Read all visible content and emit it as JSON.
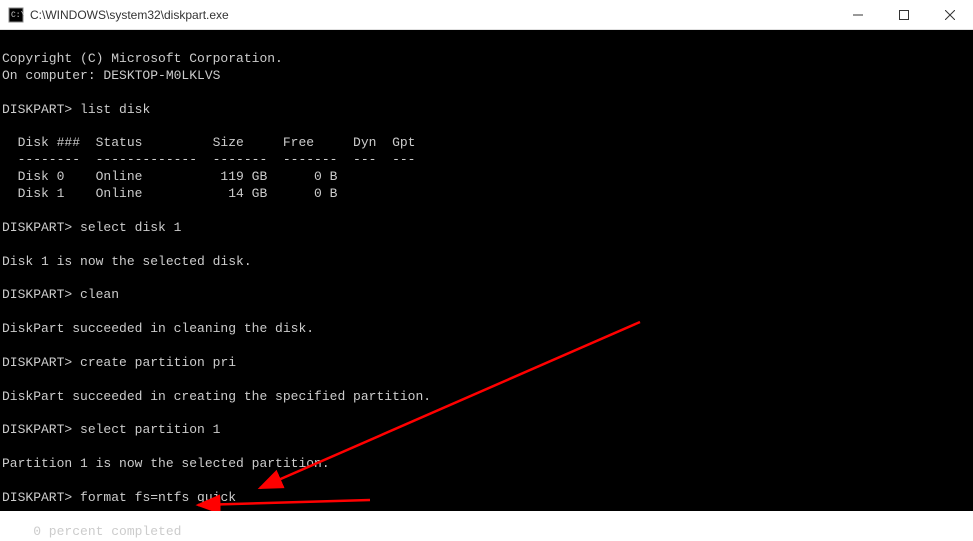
{
  "titlebar": {
    "title": "C:\\WINDOWS\\system32\\diskpart.exe"
  },
  "console": {
    "copyright": "Copyright (C) Microsoft Corporation.",
    "computer_line": "On computer: DESKTOP-M0LKLVS",
    "prompt": "DISKPART>",
    "cmd_list_disk": "list disk",
    "table_header": "  Disk ###  Status         Size     Free     Dyn  Gpt",
    "table_divider": "  --------  -------------  -------  -------  ---  ---",
    "disk0_row": "  Disk 0    Online          119 GB      0 B",
    "disk1_row": "  Disk 1    Online           14 GB      0 B",
    "cmd_select_disk": "select disk 1",
    "msg_disk_selected": "Disk 1 is now the selected disk.",
    "cmd_clean": "clean",
    "msg_clean_success": "DiskPart succeeded in cleaning the disk.",
    "cmd_create_partition": "create partition pri",
    "msg_partition_success": "DiskPart succeeded in creating the specified partition.",
    "cmd_select_partition": "select partition 1",
    "msg_partition_selected": "Partition 1 is now the selected partition.",
    "cmd_format": "format fs=ntfs quick",
    "msg_progress": "    0 percent completed"
  }
}
